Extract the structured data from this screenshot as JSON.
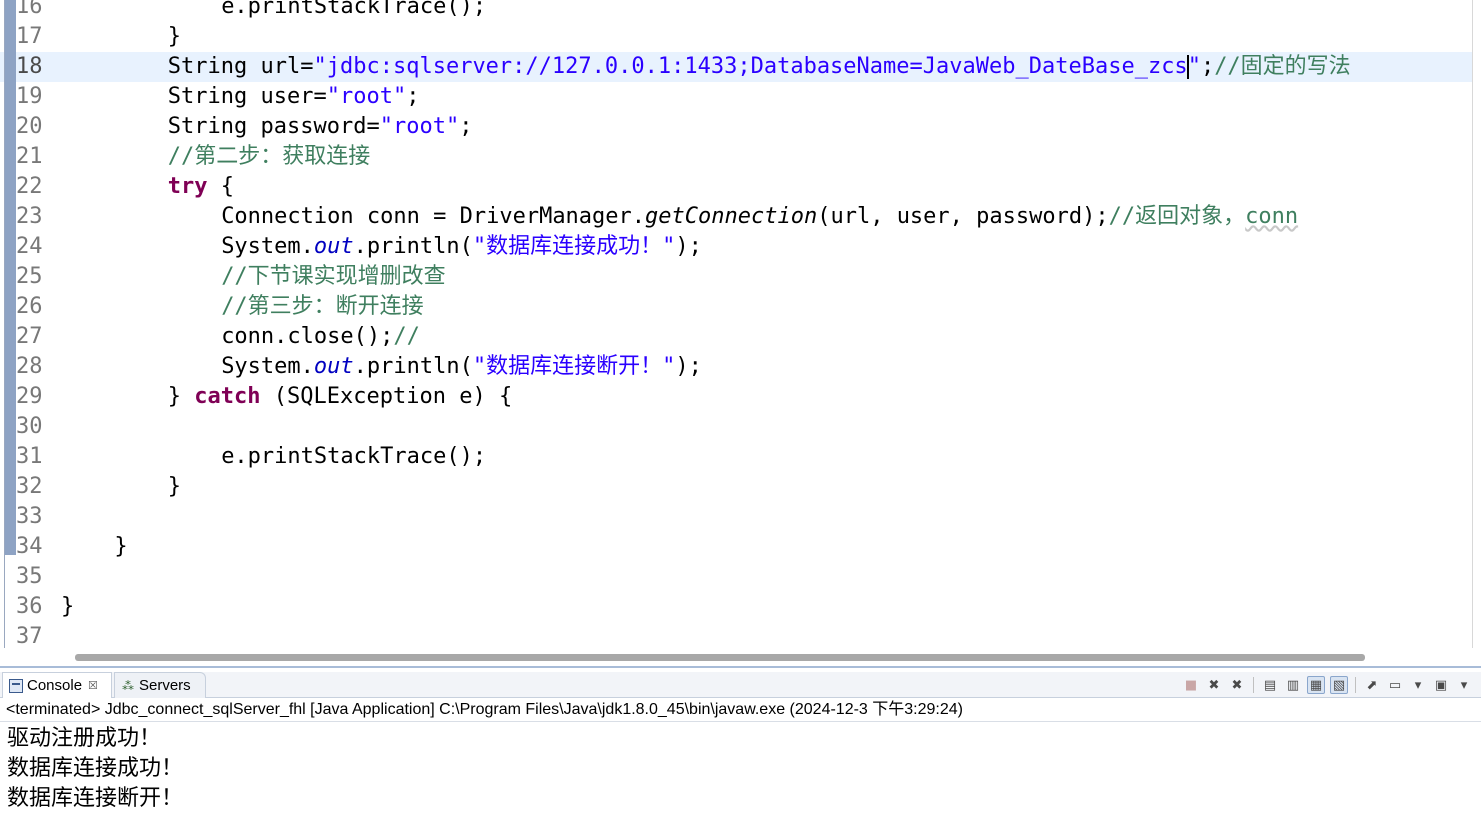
{
  "editor": {
    "lines": [
      {
        "n": "16",
        "indent": 12,
        "segments": [
          {
            "t": "e.printStackTrace();",
            "c": "plain"
          }
        ]
      },
      {
        "n": "17",
        "indent": 8,
        "segments": [
          {
            "t": "}",
            "c": "plain"
          }
        ]
      },
      {
        "n": "18",
        "indent": 8,
        "current": true,
        "segments": [
          {
            "t": "String url=",
            "c": "plain"
          },
          {
            "t": "\"jdbc:sqlserver://127.0.0.1:1433;DatabaseName=JavaWeb_DateBase_zcs",
            "c": "str"
          },
          {
            "t": "",
            "c": "caret"
          },
          {
            "t": "\"",
            "c": "str"
          },
          {
            "t": ";",
            "c": "plain"
          },
          {
            "t": "//固定的写法",
            "c": "cmt"
          }
        ]
      },
      {
        "n": "19",
        "indent": 8,
        "segments": [
          {
            "t": "String user=",
            "c": "plain"
          },
          {
            "t": "\"root\"",
            "c": "str"
          },
          {
            "t": ";",
            "c": "plain"
          }
        ]
      },
      {
        "n": "20",
        "indent": 8,
        "segments": [
          {
            "t": "String password=",
            "c": "plain"
          },
          {
            "t": "\"root\"",
            "c": "str"
          },
          {
            "t": ";",
            "c": "plain"
          }
        ]
      },
      {
        "n": "21",
        "indent": 8,
        "segments": [
          {
            "t": "//第二步：获取连接",
            "c": "cmt"
          }
        ]
      },
      {
        "n": "22",
        "indent": 8,
        "segments": [
          {
            "t": "try",
            "c": "kw"
          },
          {
            "t": " {",
            "c": "plain"
          }
        ]
      },
      {
        "n": "23",
        "indent": 12,
        "segments": [
          {
            "t": "Connection conn = DriverManager.",
            "c": "plain"
          },
          {
            "t": "getConnection",
            "c": "mth"
          },
          {
            "t": "(url, user, password);",
            "c": "plain"
          },
          {
            "t": "//返回对象，",
            "c": "cmt"
          },
          {
            "t": "conn",
            "c": "cmt-spell"
          }
        ]
      },
      {
        "n": "24",
        "indent": 12,
        "segments": [
          {
            "t": "System.",
            "c": "plain"
          },
          {
            "t": "out",
            "c": "fld"
          },
          {
            "t": ".println(",
            "c": "plain"
          },
          {
            "t": "\"数据库连接成功！\"",
            "c": "str"
          },
          {
            "t": ");",
            "c": "plain"
          }
        ]
      },
      {
        "n": "25",
        "indent": 12,
        "segments": [
          {
            "t": "//下节课实现增删改查",
            "c": "cmt"
          }
        ]
      },
      {
        "n": "26",
        "indent": 12,
        "segments": [
          {
            "t": "//第三步：断开连接",
            "c": "cmt"
          }
        ]
      },
      {
        "n": "27",
        "indent": 12,
        "segments": [
          {
            "t": "conn.close();",
            "c": "plain"
          },
          {
            "t": "//",
            "c": "cmt"
          }
        ]
      },
      {
        "n": "28",
        "indent": 12,
        "segments": [
          {
            "t": "System.",
            "c": "plain"
          },
          {
            "t": "out",
            "c": "fld"
          },
          {
            "t": ".println(",
            "c": "plain"
          },
          {
            "t": "\"数据库连接断开！\"",
            "c": "str"
          },
          {
            "t": ");",
            "c": "plain"
          }
        ]
      },
      {
        "n": "29",
        "indent": 8,
        "segments": [
          {
            "t": "} ",
            "c": "plain"
          },
          {
            "t": "catch",
            "c": "kw"
          },
          {
            "t": " (SQLException e) {",
            "c": "plain"
          }
        ]
      },
      {
        "n": "30",
        "indent": 0,
        "segments": []
      },
      {
        "n": "31",
        "indent": 12,
        "segments": [
          {
            "t": "e.printStackTrace();",
            "c": "plain"
          }
        ]
      },
      {
        "n": "32",
        "indent": 8,
        "segments": [
          {
            "t": "}",
            "c": "plain"
          }
        ]
      },
      {
        "n": "33",
        "indent": 0,
        "segments": []
      },
      {
        "n": "34",
        "indent": 4,
        "segments": [
          {
            "t": "}",
            "c": "plain"
          }
        ]
      },
      {
        "n": "35",
        "indent": 0,
        "segments": []
      },
      {
        "n": "36",
        "indent": 0,
        "segments": [
          {
            "t": "}",
            "c": "plain"
          }
        ]
      },
      {
        "n": "37",
        "indent": 0,
        "segments": []
      }
    ]
  },
  "console": {
    "tabs": {
      "console_label": "Console",
      "servers_label": "Servers",
      "close_glyph": "☒"
    },
    "toolbar_icons": [
      "terminate-icon",
      "remove-launch-icon",
      "remove-all-terminated-icon",
      "clear-console-icon",
      "scroll-lock-icon",
      "word-wrap-icon",
      "show-on-output-icon",
      "pin-console-icon",
      "display-selected-console-icon",
      "open-console-icon"
    ],
    "status": "<terminated> Jdbc_connect_sqlServer_fhl [Java Application] C:\\Program Files\\Java\\jdk1.8.0_45\\bin\\javaw.exe (2024-12-3 下午3:29:24)",
    "output": [
      "驱动注册成功！",
      "数据库连接成功！",
      "数据库连接断开！"
    ]
  },
  "colors": {
    "keyword": "#7f0055",
    "string": "#2a00ff",
    "comment": "#3f7f5f",
    "field": "#0000c0",
    "current_line": "#e8f2fe"
  }
}
